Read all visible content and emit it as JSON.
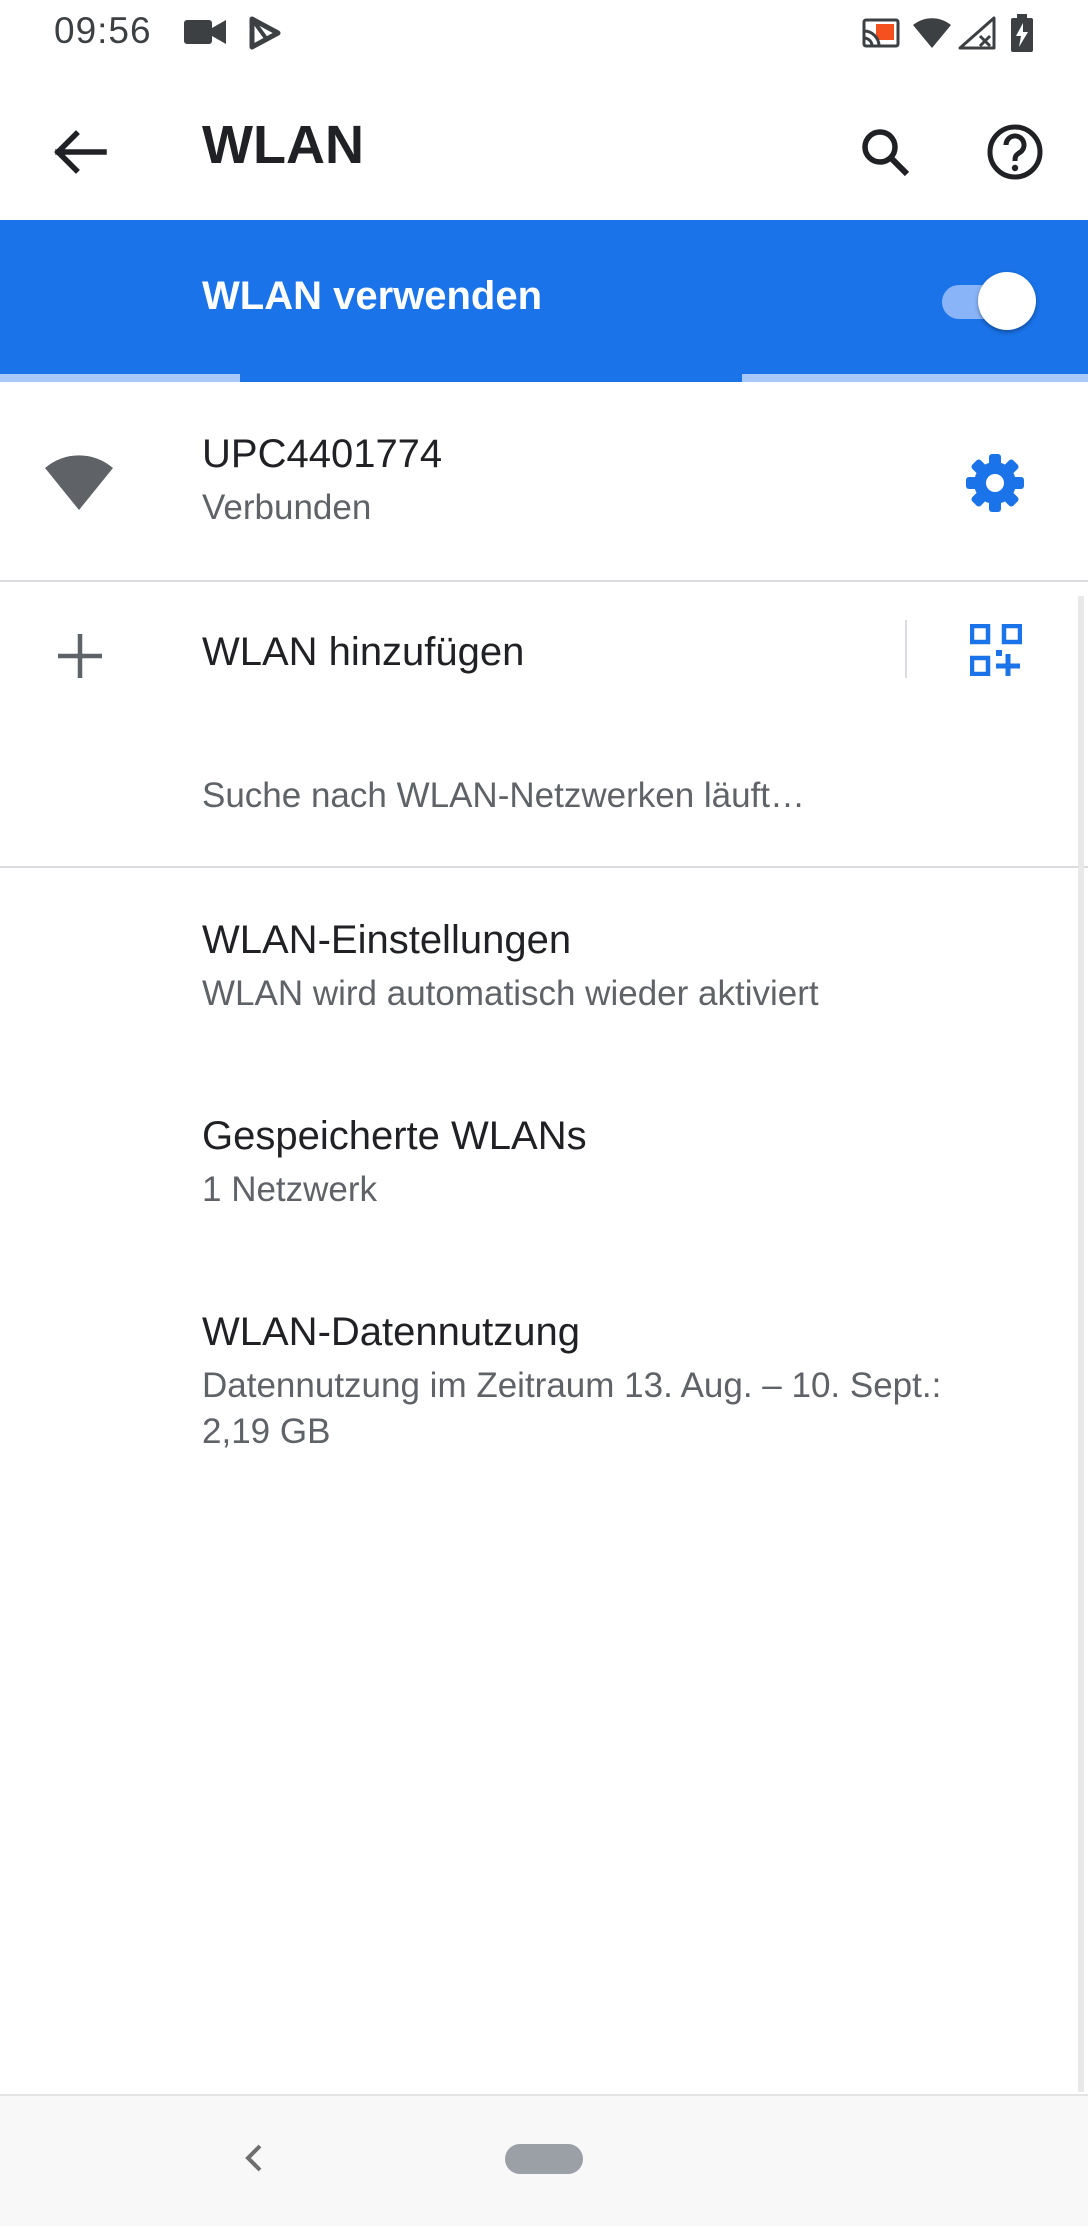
{
  "status_bar": {
    "time": "09:56",
    "left_icons": [
      "videocam-icon",
      "play-store-icon"
    ],
    "right_icons": [
      "cast-icon",
      "wifi-icon",
      "no-signal-icon",
      "battery-charging-icon"
    ]
  },
  "app_bar": {
    "title": "WLAN",
    "back_icon": "arrow-back-icon",
    "search_icon": "search-icon",
    "help_icon": "help-icon"
  },
  "main_switch": {
    "label": "WLAN verwenden",
    "enabled": true
  },
  "connected_network": {
    "ssid": "UPC4401774",
    "status": "Verbunden",
    "signal_icon": "wifi-signal-icon",
    "settings_icon": "gear-icon"
  },
  "add_network": {
    "label": "WLAN hinzufügen",
    "add_icon": "plus-icon",
    "qr_icon": "qr-code-scan-icon"
  },
  "scan_status": "Suche nach WLAN-Netzwerken läuft…",
  "settings_list": [
    {
      "title": "WLAN-Einstellungen",
      "subtitle": "WLAN wird automatisch wieder aktiviert"
    },
    {
      "title": "Gespeicherte WLANs",
      "subtitle": "1 Netzwerk"
    },
    {
      "title": "WLAN-Datennutzung",
      "subtitle_line1": "Datennutzung im Zeitraum 13. Aug. – 10. Sept.:",
      "subtitle_line2": "2,19 GB"
    }
  ],
  "colors": {
    "accent": "#1a73e8",
    "text_primary": "#202124",
    "text_secondary": "#5f6368"
  },
  "nav_bar": {
    "back_icon": "nav-back-chevron-icon",
    "home_icon": "home-pill-icon"
  }
}
